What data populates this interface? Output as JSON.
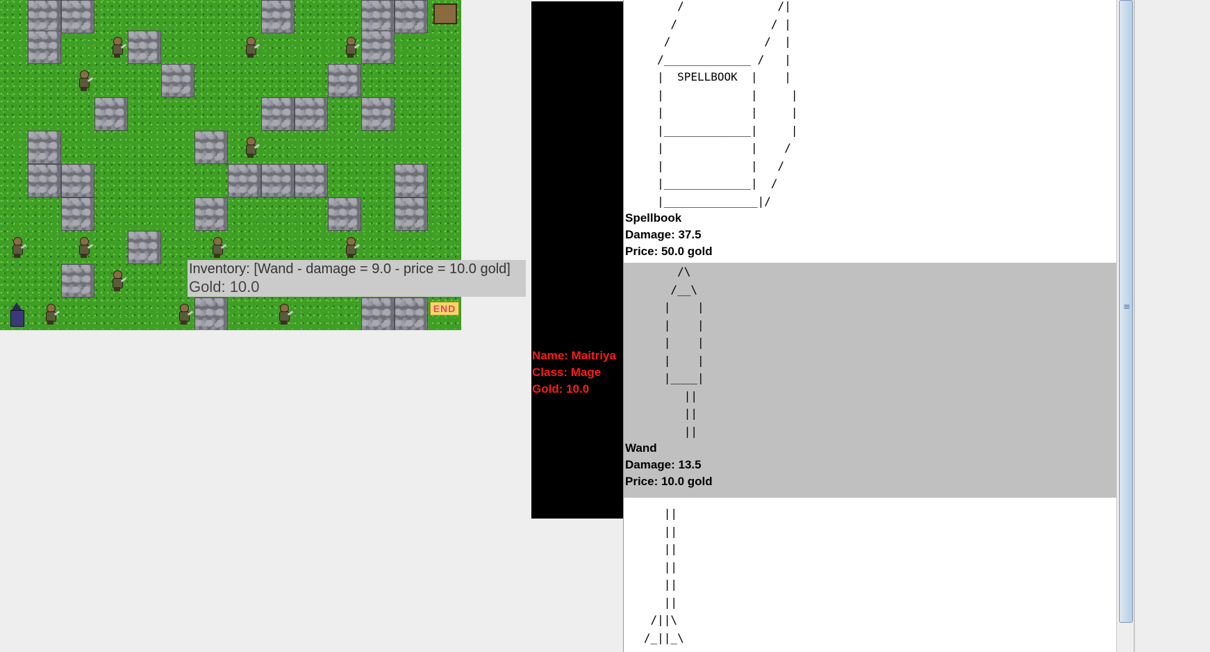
{
  "inventory": {
    "items_text": "Inventory: [Wand - damage = 9.0 - price = 10.0 gold]",
    "gold_text": "Gold: 10.0"
  },
  "map": {
    "end_label": "END"
  },
  "player": {
    "name_line": "Name: Maitriya",
    "class_line": "Class: Mage",
    "gold_line": "Gold: 10.0"
  },
  "shop": {
    "items": [
      {
        "ascii": "        /              /|\n       /              / |\n      /              /  |\n     /_____________ /   |\n     |  SPELLBOOK  |    |\n     |             |     |\n     |             |     |\n     |_____________|     |\n     |             |    /\n     |             |   /\n     |_____________|  /\n     |______________|/",
        "name": "Spellbook",
        "damage": "Damage: 37.5",
        "price": "Price: 50.0 gold"
      },
      {
        "ascii": "        /\\\n       /__\\\n      |    |\n      |    |\n      |    |\n      |    |\n      |____|\n         ||\n         ||\n         ||",
        "name": "Wand",
        "damage": "Damage: 13.5",
        "price": "Price: 10.0 gold"
      },
      {
        "ascii": "      ||\n      ||\n      ||\n      ||\n      ||\n      ||\n    /||\\\n   /_||_\\",
        "name": "",
        "damage": "",
        "price": ""
      }
    ]
  },
  "scrollbar": {
    "grip_icon": "grip-lines-icon"
  }
}
